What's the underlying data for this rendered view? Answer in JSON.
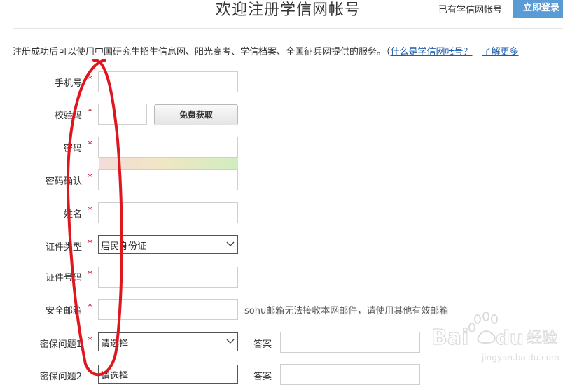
{
  "header": {
    "title": "欢迎注册学信网帐号",
    "have_account": "已有学信网帐号",
    "login_button": "立即登录"
  },
  "intro": {
    "text": "注册成功后可以使用中国研究生招生信息网、阳光高考、学信档案、全国征兵网提供的服务。（",
    "link_what": "什么是学信网帐号？",
    "link_more": "了解更多"
  },
  "form": {
    "phone_label": "手机号",
    "code_label": "校验码",
    "get_code_button": "免费获取",
    "password_label": "密码",
    "confirm_label": "密码确认",
    "name_label": "姓名",
    "id_type_label": "证件类型",
    "id_type_value": "居民身份证",
    "id_number_label": "证件号码",
    "email_label": "安全邮箱",
    "email_hint": "sohu邮箱无法接收本网邮件，请使用其他有效邮箱",
    "q1_label": "密保问题1",
    "q1_value": "请选择",
    "answer1_label": "答案",
    "q2_label": "密保问题2",
    "q2_value": "请选择",
    "answer2_label": "答案",
    "required_mark": "*"
  },
  "watermark": {
    "brand": "Baidu经验",
    "url": "jingyan.baidu.com"
  },
  "colors": {
    "accent": "#5b9bd5",
    "link": "#1a5da8",
    "required": "#d0021b",
    "annotation": "#e0161e"
  }
}
